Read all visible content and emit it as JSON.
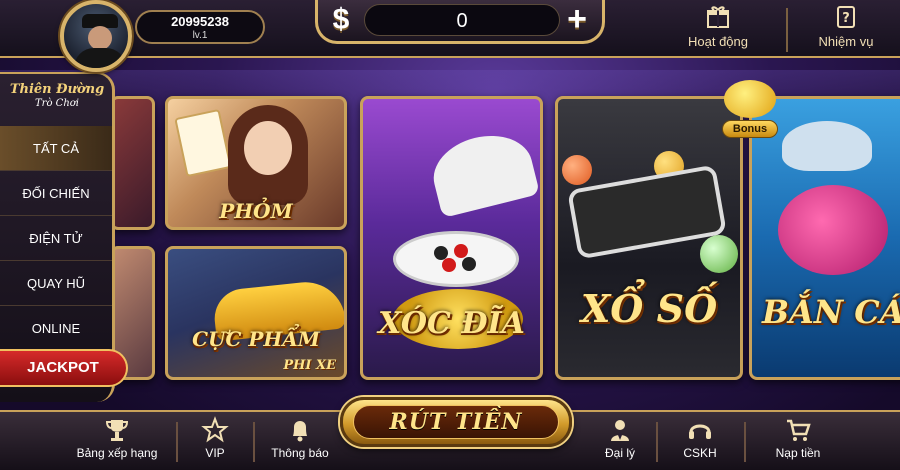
{
  "header": {
    "balance": "20995238",
    "level": "lv.1",
    "coins": "0",
    "dollar_symbol": "$",
    "plus_symbol": "+",
    "actions": [
      {
        "label": "Hoạt động",
        "icon": "gift-box-icon"
      },
      {
        "label": "Nhiệm vụ",
        "icon": "quest-scroll-icon"
      }
    ]
  },
  "sidebar": {
    "logo_line1": "Thiên Đường",
    "logo_line2": "Trò Chơi",
    "items": [
      {
        "label": "TẤT CẢ",
        "active": true
      },
      {
        "label": "ĐỐI CHIẾN",
        "active": false
      },
      {
        "label": "ĐIỆN TỬ",
        "active": false
      },
      {
        "label": "QUAY HŨ",
        "active": false
      },
      {
        "label": "ONLINE",
        "active": false
      }
    ],
    "jackpot_label": "JACKPOT"
  },
  "games": {
    "phom": "PHỎM",
    "xe_title": "CỰC PHẨM",
    "xe_sub": "PHI XE",
    "xoc": "XÓC ĐĨA",
    "xoso": "XỔ SỐ",
    "banca": "BẮN CÁ",
    "bonus_label": "Bonus"
  },
  "bottom": {
    "withdraw_label": "RÚT TIỀN",
    "items": [
      {
        "label": "Bảng xếp hạng",
        "icon": "trophy-icon"
      },
      {
        "label": "VIP",
        "icon": "vip-star-icon"
      },
      {
        "label": "Thông báo",
        "icon": "bell-icon"
      },
      {
        "label": "Đại lý",
        "icon": "agent-icon"
      },
      {
        "label": "CSKH",
        "icon": "headset-icon"
      },
      {
        "label": "Nạp tiền",
        "icon": "cart-icon"
      }
    ]
  },
  "colors": {
    "gold_border": "#c9a25a",
    "title_gold": "#ffe58a",
    "jackpot_red": "#d62a2a"
  }
}
